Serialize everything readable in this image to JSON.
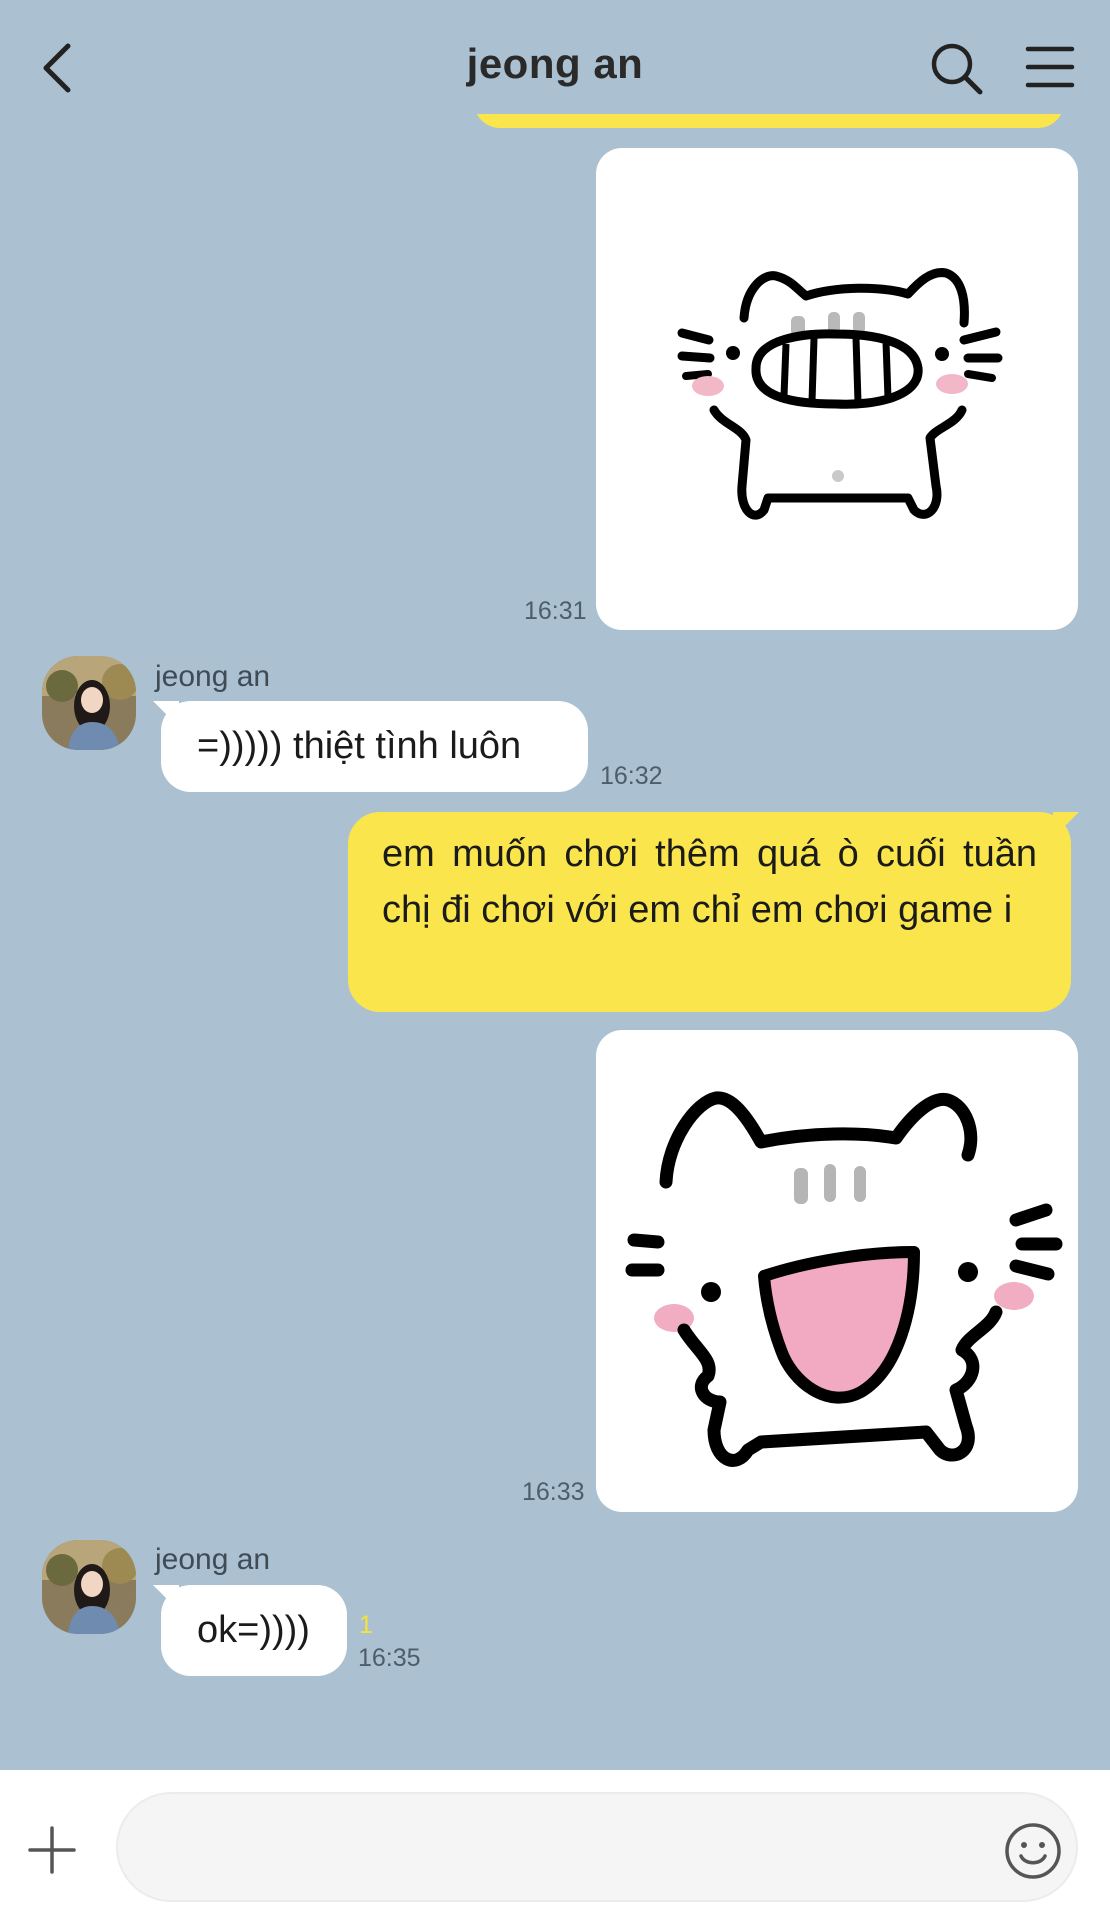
{
  "header": {
    "title": "jeong an",
    "icons": [
      "back-arrow-icon",
      "search-icon",
      "menu-icon"
    ]
  },
  "messages": {
    "sticker1": {
      "time": "16:31"
    },
    "msg1": {
      "sender": "jeong an",
      "text": "=))))) thiệt tình luôn",
      "time": "16:32"
    },
    "msg2": {
      "text": "em muốn chơi thêm quá ò cuối tuần chị đi chơi với em chỉ em chơi game i"
    },
    "sticker2": {
      "time": "16:33"
    },
    "msg3": {
      "sender": "jeong an",
      "text": "ok=))))",
      "unread": "1",
      "time": "16:35"
    }
  },
  "composer": {
    "placeholder": "",
    "icons": [
      "plus-icon",
      "emoji-icon"
    ]
  },
  "colors": {
    "background": "#abc1d1",
    "outgoing_bubble": "#fae54c",
    "incoming_bubble": "#ffffff"
  }
}
